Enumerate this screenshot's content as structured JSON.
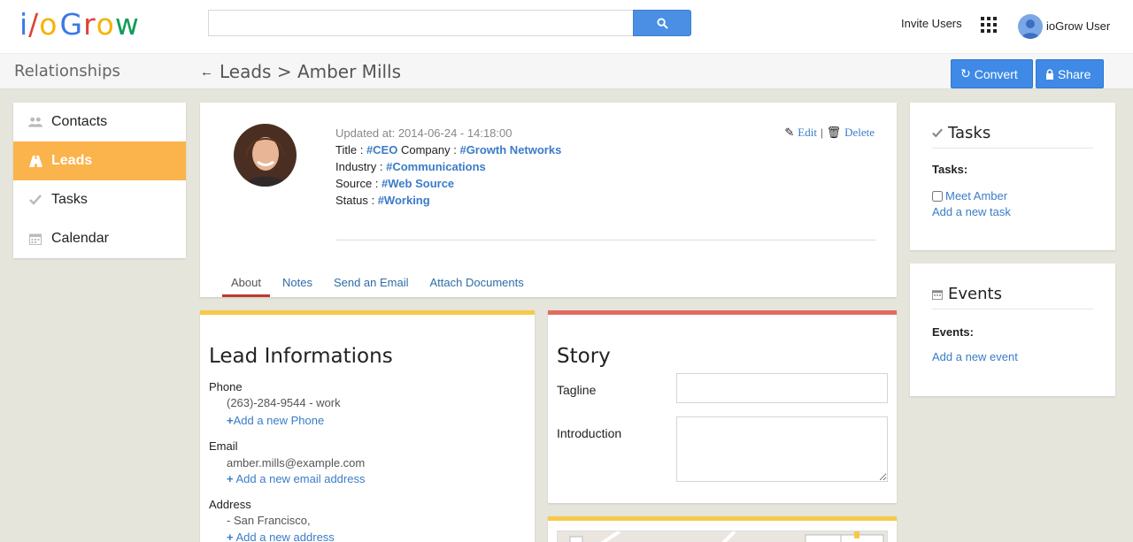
{
  "header": {
    "logo_letters": [
      "i",
      "/",
      "o",
      " ",
      "G",
      "r",
      "o",
      "w"
    ],
    "logo_colors": [
      "#3b78e7",
      "#db4437",
      "#f4b400",
      "#000000",
      "#3b78e7",
      "#db4437",
      "#f4b400",
      "#0f9d58"
    ],
    "search_placeholder": "",
    "invite_label": "Invite Users",
    "username": "ioGrow User"
  },
  "subbar": {
    "section": "Relationships",
    "breadcrumb": "Leads > Amber Mills",
    "convert_label": "Convert",
    "share_label": "Share"
  },
  "sidebar": {
    "items": [
      {
        "label": "Contacts",
        "icon": "users-icon"
      },
      {
        "label": "Leads",
        "icon": "road-icon"
      },
      {
        "label": "Tasks",
        "icon": "check-icon"
      },
      {
        "label": "Calendar",
        "icon": "calendar-icon"
      }
    ],
    "active": "Leads"
  },
  "profile": {
    "updated": "Updated at: 2014-06-24 - 14:18:00",
    "title_label": "Title :",
    "title_value": "#CEO",
    "company_label": "Company :",
    "company_value": "#Growth Networks",
    "industry_label": "Industry :",
    "industry_value": "#Communications",
    "source_label": "Source :",
    "source_value": "#Web Source",
    "status_label": "Status :",
    "status_value": "#Working",
    "edit_label": "Edit",
    "delete_label": "Delete",
    "tabs": [
      "About",
      "Notes",
      "Send an Email",
      "Attach Documents"
    ]
  },
  "lead_info": {
    "heading": "Lead Informations",
    "phone_label": "Phone",
    "phone_value": "(263)-284-9544 - work",
    "add_phone": "Add a new Phone",
    "email_label": "Email",
    "email_value": "amber.mills@example.com",
    "add_email": "Add a new email address",
    "address_label": "Address",
    "address_value": "- San Francisco,",
    "add_address": "Add a new address"
  },
  "story": {
    "heading": "Story",
    "tagline_label": "Tagline",
    "tagline_value": "",
    "intro_label": "Introduction",
    "intro_value": ""
  },
  "tasks": {
    "heading": "Tasks",
    "sublabel": "Tasks:",
    "items": [
      "Meet Amber"
    ],
    "add_label": "Add a new task"
  },
  "events": {
    "heading": "Events",
    "sublabel": "Events:",
    "add_label": "Add a new event"
  },
  "colors": {
    "accent": "#3e8ae6",
    "active_nav": "#fbb34b",
    "lead_border": "#f7c948",
    "story_border": "#e06c60"
  }
}
